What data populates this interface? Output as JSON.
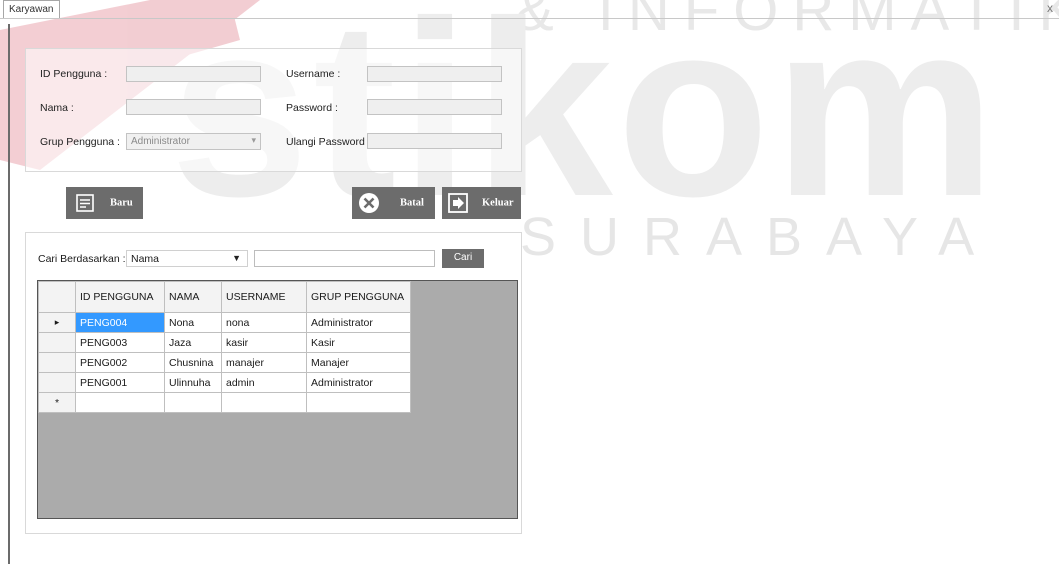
{
  "tab": {
    "title": "Karyawan",
    "close": "x"
  },
  "form": {
    "id_label": "ID Pengguna :",
    "id_value": "",
    "nama_label": "Nama :",
    "nama_value": "",
    "grup_label": "Grup Pengguna :",
    "grup_value": "Administrator",
    "username_label": "Username :",
    "username_value": "",
    "password_label": "Password :",
    "password_value": "",
    "ulangi_label": "Ulangi Password :",
    "ulangi_value": ""
  },
  "buttons": {
    "baru": "Baru",
    "batal": "Batal",
    "keluar": "Keluar"
  },
  "search": {
    "label": "Cari Berdasarkan :",
    "field": "Nama",
    "query": "",
    "button": "Cari"
  },
  "grid": {
    "headers": [
      "ID PENGGUNA",
      "NAMA",
      "USERNAME",
      "GRUP PENGGUNA"
    ],
    "rows": [
      [
        "PENG004",
        "Nona",
        "nona",
        "Administrator"
      ],
      [
        "PENG003",
        "Jaza",
        "kasir",
        "Kasir"
      ],
      [
        "PENG002",
        "Chusnina",
        "manajer",
        "Manajer"
      ],
      [
        "PENG001",
        "Ulinnuha",
        "admin",
        "Administrator"
      ]
    ],
    "current_row_marker": "▸",
    "new_row_marker": "*"
  },
  "watermark": {
    "line1": "& INFORMATIKA",
    "brand": "stikom",
    "line2": "SURABAYA"
  },
  "colors": {
    "button": "#6c6c6c",
    "selection": "#3399ff",
    "grid_bg": "#ababab",
    "watermark": "#f4cfd3"
  }
}
